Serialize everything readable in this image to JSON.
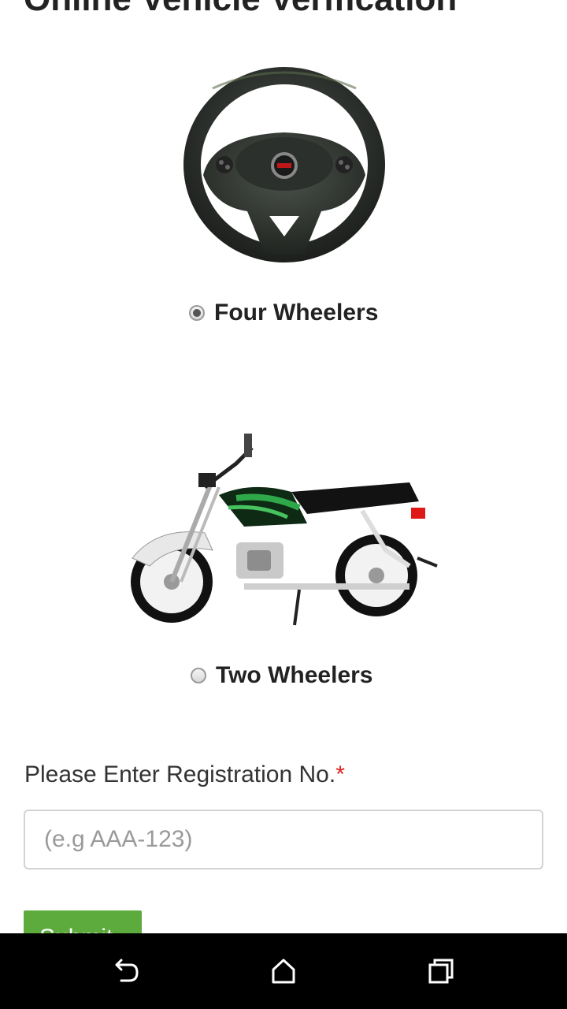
{
  "page": {
    "title": "Online Vehicle Verification"
  },
  "vehicle_options": [
    {
      "label": "Four Wheelers",
      "selected": true,
      "image": "steering-wheel"
    },
    {
      "label": "Two Wheelers",
      "selected": false,
      "image": "motorcycle"
    }
  ],
  "form": {
    "label": "Please Enter Registration No.",
    "required_mark": "*",
    "placeholder": "(e.g AAA-123)",
    "value": "",
    "submit_label": "Submit"
  },
  "navbar": {
    "icons": [
      "back-icon",
      "home-icon",
      "recent-apps-icon"
    ]
  },
  "colors": {
    "submit_bg": "#5cab3c",
    "required": "#e02020",
    "navbar_bg": "#000000"
  }
}
